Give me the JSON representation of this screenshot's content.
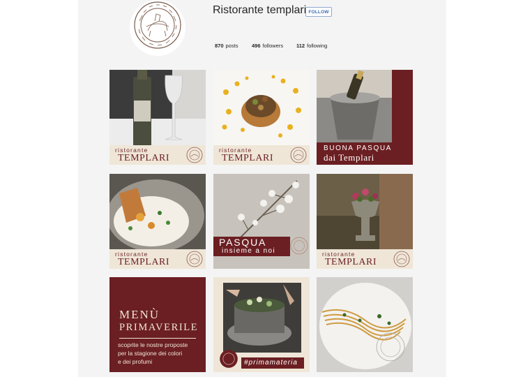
{
  "profile": {
    "username": "Ristorante templari",
    "follow_label": "FOLLOW",
    "posts_count": "870",
    "posts_label": "posts",
    "followers_count": "496",
    "followers_label": "followers",
    "following_count": "112",
    "following_label": "following"
  },
  "posts": [
    {
      "small": "ristorante",
      "big": "TEMPLARI"
    },
    {
      "small": "ristorante",
      "big": "TEMPLARI"
    },
    {
      "line1": "BUONA PASQUA",
      "line2": "dai Templari"
    },
    {
      "small": "ristorante",
      "big": "TEMPLARI"
    },
    {
      "line1": "PASQUA",
      "line2": "insieme a noi"
    },
    {
      "small": "ristorante",
      "big": "TEMPLARI"
    },
    {
      "line1": "MENÙ",
      "line2": "PRIMAVERILE",
      "body1": "scoprite le nostre proposte",
      "body2": "per la stagione dei colori",
      "body3": "e dei profumi"
    },
    {
      "hashtag": "#primamateria"
    },
    {}
  ],
  "colors": {
    "brand_maroon": "#6b1f22",
    "band_cream": "#efe6d8",
    "follow_blue": "#3c6bb4"
  }
}
